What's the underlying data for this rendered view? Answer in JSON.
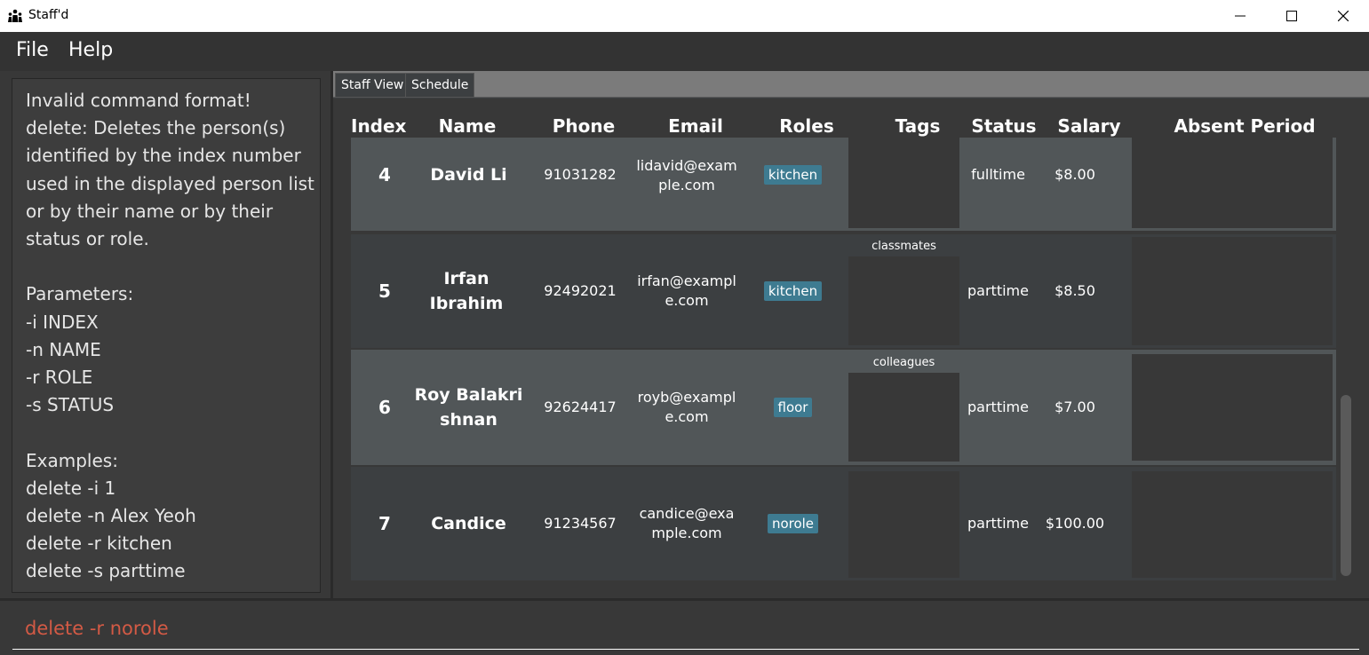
{
  "window": {
    "title": "Staff'd",
    "minimize_icon": "minimize-icon",
    "maximize_icon": "maximize-icon",
    "close_icon": "close-icon"
  },
  "menu": {
    "items": [
      {
        "label": "File"
      },
      {
        "label": "Help"
      }
    ]
  },
  "result": {
    "text": "Invalid command format! \ndelete: Deletes the person(s) identified by the index number used in the displayed person list or by their name or by their status or role.\n\nParameters:\n-i INDEX\n-n NAME\n-r ROLE\n-s STATUS\n\nExamples:\ndelete -i 1\ndelete -n Alex Yeoh\ndelete -r kitchen\ndelete -s parttime"
  },
  "tabs": [
    {
      "label": "Staff View"
    },
    {
      "label": "Schedule"
    }
  ],
  "table": {
    "headers": {
      "index": "Index",
      "name": "Name",
      "phone": "Phone",
      "email": "Email",
      "roles": "Roles",
      "tags": "Tags",
      "status": "Status",
      "salary": "Salary",
      "absent": "Absent Period"
    },
    "rows": [
      {
        "index": "4",
        "name": "David Li",
        "phone": "91031282",
        "email": "lidavid@example.com",
        "role": "kitchen",
        "tag": "",
        "status": "fulltime",
        "salary": "$8.00"
      },
      {
        "index": "5",
        "name": "Irfan Ibrahim",
        "phone": "92492021",
        "email": "irfan@example.com",
        "role": "kitchen",
        "tag": "classmates",
        "status": "parttime",
        "salary": "$8.50"
      },
      {
        "index": "6",
        "name": "Roy Balakrishnan",
        "phone": "92624417",
        "email": "royb@example.com",
        "role": "floor",
        "tag": "colleagues",
        "status": "parttime",
        "salary": "$7.00"
      },
      {
        "index": "7",
        "name": "Candice",
        "phone": "91234567",
        "email": "candice@example.com",
        "role": "norole",
        "tag": "",
        "status": "parttime",
        "salary": "$100.00"
      }
    ]
  },
  "command": {
    "value": "delete -r norole"
  },
  "colors": {
    "background": "#3c3f41",
    "row_selected": "#515658",
    "role_tag": "#3e7b91",
    "command_text": "#d35a45"
  }
}
